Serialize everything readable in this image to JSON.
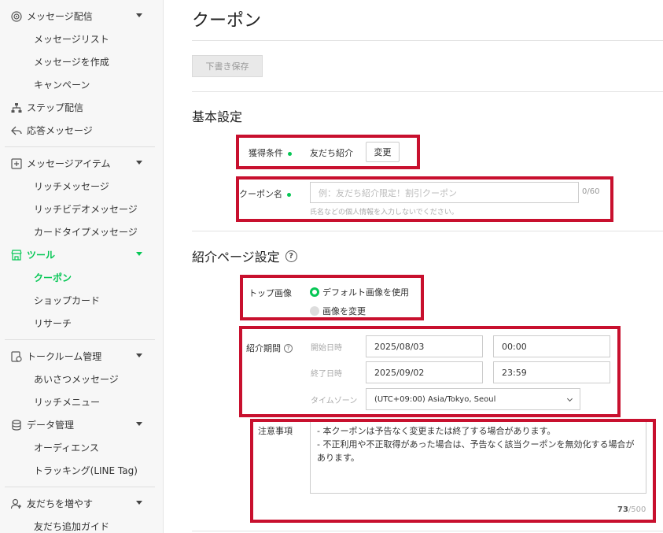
{
  "sidebar": {
    "sections": [
      {
        "label": "メッセージ配信",
        "items": [
          "メッセージリスト",
          "メッセージを作成",
          "キャンペーン"
        ]
      },
      {
        "label": "ステップ配信"
      },
      {
        "label": "応答メッセージ"
      },
      {
        "label": "メッセージアイテム",
        "items": [
          "リッチメッセージ",
          "リッチビデオメッセージ",
          "カードタイプメッセージ"
        ]
      },
      {
        "label": "ツール",
        "items": [
          "クーポン",
          "ショップカード",
          "リサーチ"
        ]
      },
      {
        "label": "トークルーム管理",
        "items": [
          "あいさつメッセージ",
          "リッチメニュー"
        ]
      },
      {
        "label": "データ管理",
        "items": [
          "オーディエンス",
          "トラッキング(LINE Tag)"
        ]
      },
      {
        "label": "友だちを増やす",
        "items": [
          "友だち追加ガイド"
        ]
      }
    ]
  },
  "page": {
    "title": "クーポン",
    "draft_button": "下書き保存"
  },
  "basic": {
    "heading": "基本設定",
    "condition_label": "獲得条件",
    "condition_value": "友だち紹介",
    "change_button": "変更",
    "coupon_name_label": "クーポン名",
    "coupon_name_placeholder": "例：友だち紹介限定！割引クーポン",
    "coupon_name_count": "0/60",
    "coupon_name_hint": "氏名などの個人情報を入力しないでください。"
  },
  "intro": {
    "heading": "紹介ページ設定",
    "help_icon": "?",
    "top_image_label": "トップ画像",
    "radio_default": "デフォルト画像を使用",
    "radio_change": "画像を変更",
    "period_label": "紹介期間",
    "start_label": "開始日時",
    "start_date": "2025/08/03",
    "start_time": "00:00",
    "end_label": "終了日時",
    "end_date": "2025/09/02",
    "end_time": "23:59",
    "timezone_label": "タイムゾーン",
    "timezone_value": "(UTC+09:00) Asia/Tokyo, Seoul",
    "notes_label": "注意事項",
    "notes_text": "- 本クーポンは予告なく変更または終了する場合があります。\n- 不正利用や不正取得があった場合は、予告なく該当クーポンを無効化する場合があります。",
    "notes_count_current": "73",
    "notes_count_max": "/500"
  },
  "colors": {
    "accent": "#06c755",
    "highlight": "#c8102e"
  }
}
